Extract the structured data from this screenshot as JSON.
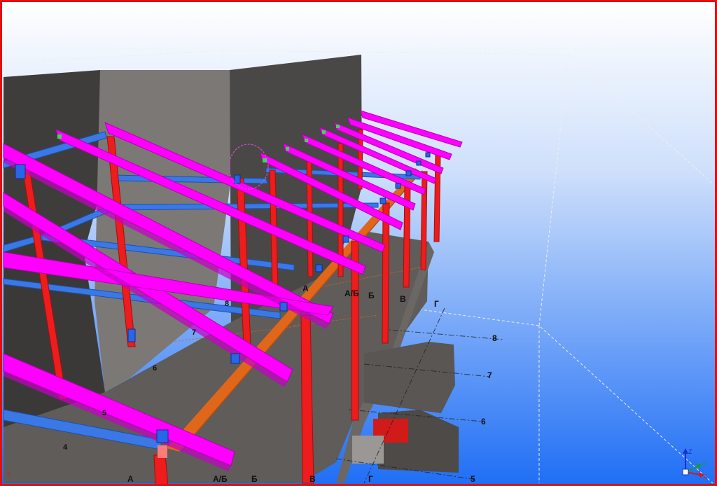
{
  "viewport": {
    "background_top": "#ffffff",
    "background_bottom": "#1e6ef5",
    "frame_color": "#e01010"
  },
  "colors": {
    "rafter": "#ff00ff",
    "column": "#ee1c1c",
    "purlin": "#3a78e6",
    "beam": "#e0661a",
    "wall": "#4a4847",
    "floor": "#5f5c59",
    "connection": "#1a4fd8"
  },
  "grid_labels": {
    "l_A_far": "А",
    "l_AB_far": "А/Б",
    "l_B_far": "Б",
    "l_V_far": "В",
    "l_G_far": "Г",
    "l_8_right": "8",
    "l_7_right": "7",
    "l_6_right": "6",
    "l_5_right": "5",
    "l_8_mid": "8",
    "l_7_mid": "7",
    "l_6_left": "6",
    "l_5_left": "5",
    "l_4_left": "4",
    "l_A_bottom": "А",
    "l_AB_bottom": "А/Б",
    "l_B_bottom": "Б",
    "l_V_bottom": "В",
    "l_G_bottom": "Г"
  },
  "axis_triad": {
    "z": "Z",
    "x": "X",
    "y": "Y"
  },
  "corner_mark": "⌗"
}
